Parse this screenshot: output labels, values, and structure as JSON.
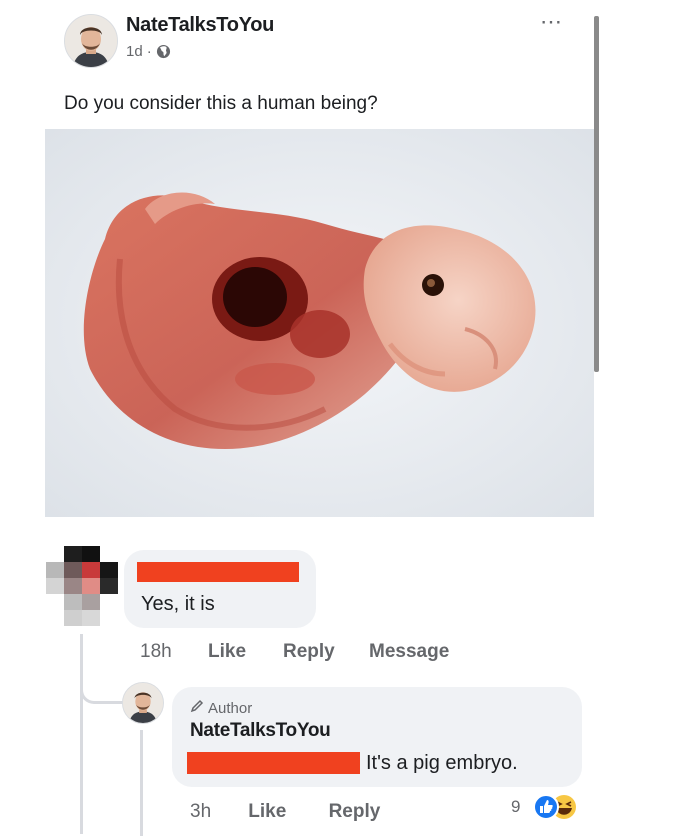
{
  "post": {
    "author": "NateTalksToYou",
    "time": "1d",
    "separator": "·",
    "text": "Do you consider this a human being?",
    "more_icon": "⋯"
  },
  "comment": {
    "text": "Yes, it is",
    "time": "18h",
    "like_label": "Like",
    "reply_label": "Reply",
    "message_label": "Message"
  },
  "reply": {
    "badge": "Author",
    "author": "NateTalksToYou",
    "text": "It's a pig embryo.",
    "time": "3h",
    "like_label": "Like",
    "reply_label": "Reply",
    "reaction_count": "9"
  },
  "icons": {
    "globe": "globe-icon",
    "pencil": "pencil-icon",
    "more": "more-options-icon",
    "like_reaction": "like-reaction-icon",
    "haha_reaction": "haha-reaction-icon"
  },
  "colors": {
    "redaction": "#f0411f",
    "bubble": "#f0f2f5",
    "muted_text": "#65676b",
    "like_blue": "#1877f2"
  }
}
